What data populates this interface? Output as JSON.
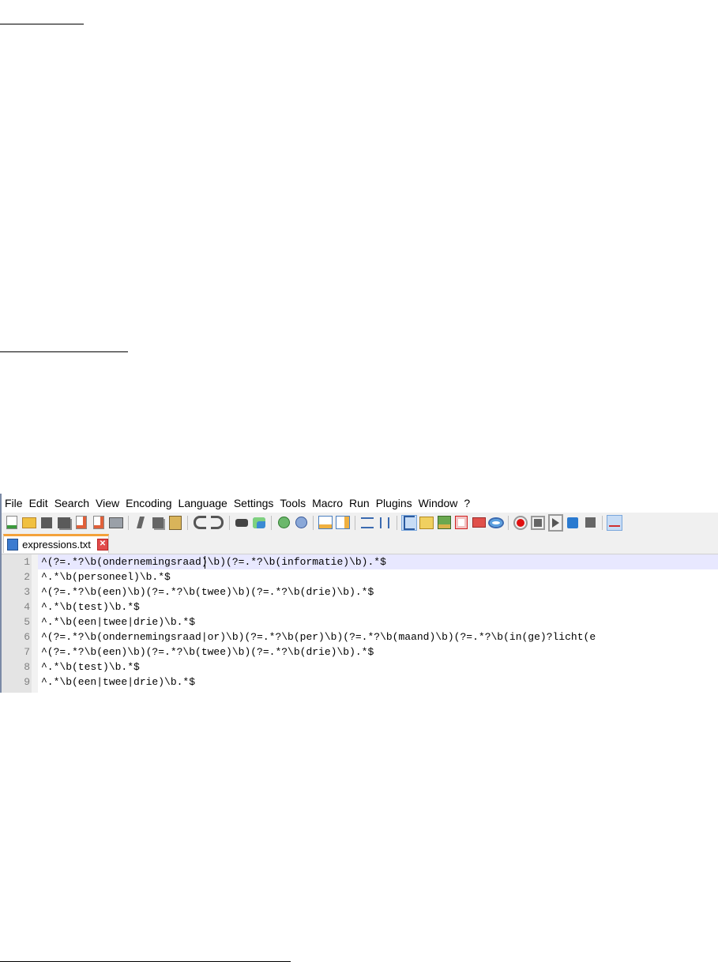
{
  "menu": [
    "File",
    "Edit",
    "Search",
    "View",
    "Encoding",
    "Language",
    "Settings",
    "Tools",
    "Macro",
    "Run",
    "Plugins",
    "Window",
    "?"
  ],
  "toolbar_icons": [
    "new-file-icon",
    "open-file-icon",
    "save-icon",
    "save-all-icon",
    "close-icon",
    "close-all-icon",
    "print-icon",
    "cut-icon",
    "copy-icon",
    "paste-icon",
    "undo-icon",
    "redo-icon",
    "find-icon",
    "replace-icon",
    "zoom-in-icon",
    "zoom-out-icon",
    "sync-vertical-icon",
    "sync-horizontal-icon",
    "word-wrap-icon",
    "show-all-characters-icon",
    "indent-guide-icon",
    "user-language-icon",
    "document-map-icon",
    "function-list-icon",
    "folder-as-workspace-icon",
    "monitoring-icon",
    "record-macro-icon",
    "stop-recording-icon",
    "playback-macro-icon",
    "run-macro-multiple-icon",
    "save-macro-icon",
    "spell-check-icon"
  ],
  "tab": {
    "filename": "expressions.txt",
    "close": "✕"
  },
  "lines": [
    {
      "n": "1",
      "text": "^(?=.*?\\b(ondernemingsraad)\\b)(?=.*?\\b(informatie)\\b).*$"
    },
    {
      "n": "2",
      "text": "^.*\\b(personeel)\\b.*$"
    },
    {
      "n": "3",
      "text": "^(?=.*?\\b(een)\\b)(?=.*?\\b(twee)\\b)(?=.*?\\b(drie)\\b).*$"
    },
    {
      "n": "4",
      "text": "^.*\\b(test)\\b.*$"
    },
    {
      "n": "5",
      "text": "^.*\\b(een|twee|drie)\\b.*$"
    },
    {
      "n": "6",
      "text": "^(?=.*?\\b(ondernemingsraad|or)\\b)(?=.*?\\b(per)\\b)(?=.*?\\b(maand)\\b)(?=.*?\\b(in(ge)?licht(e"
    },
    {
      "n": "7",
      "text": "^(?=.*?\\b(een)\\b)(?=.*?\\b(twee)\\b)(?=.*?\\b(drie)\\b).*$"
    },
    {
      "n": "8",
      "text": "^.*\\b(test)\\b.*$"
    },
    {
      "n": "9",
      "text": "^.*\\b(een|twee|drie)\\b.*$"
    }
  ]
}
